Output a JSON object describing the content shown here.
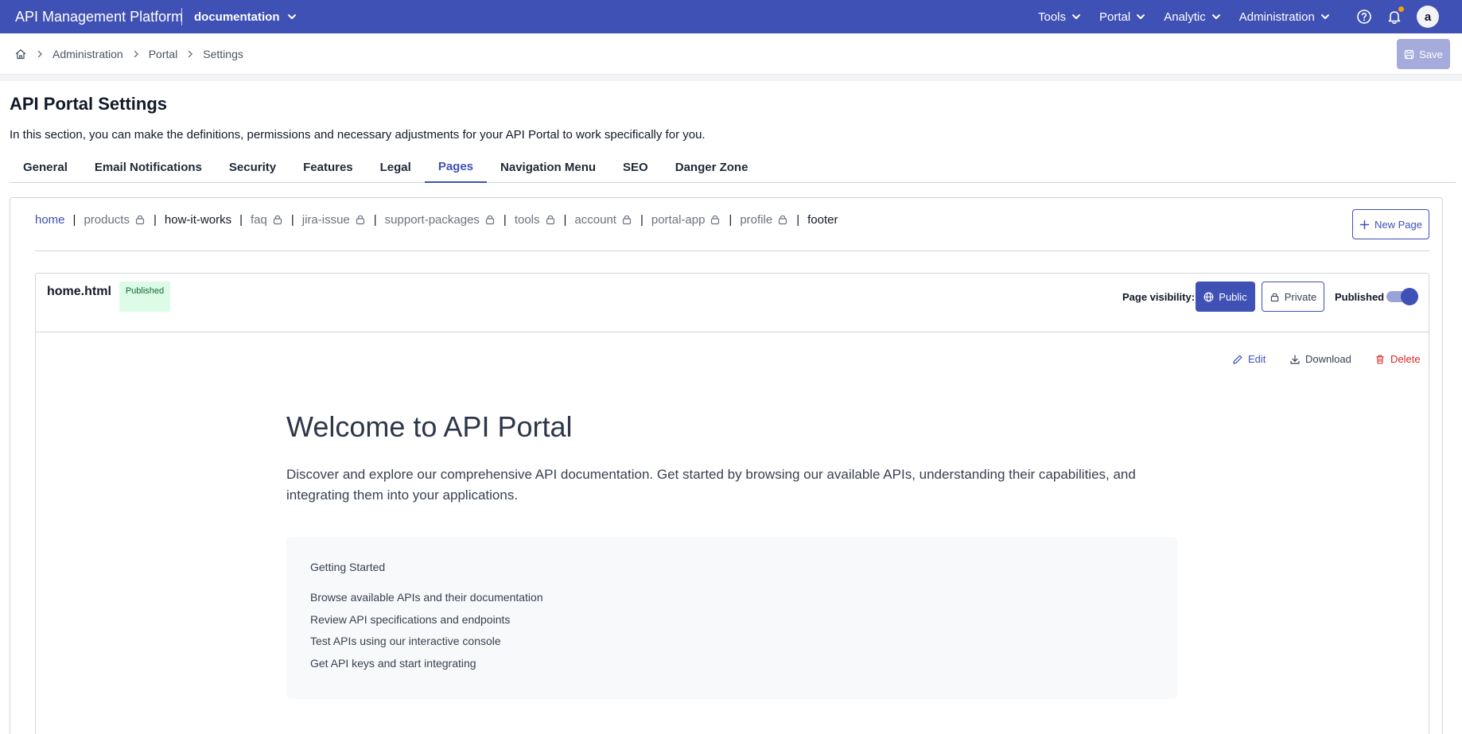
{
  "header": {
    "app_title": "API Management Platform",
    "workspace": "documentation",
    "nav": [
      "Tools",
      "Portal",
      "Analytic",
      "Administration"
    ],
    "avatar_initial": "a",
    "colors": {
      "primary": "#3f51b5",
      "notification_dot": "#f59e0b"
    }
  },
  "breadcrumb": {
    "items": [
      "Administration",
      "Portal",
      "Settings"
    ],
    "save_label": "Save"
  },
  "page": {
    "title": "API Portal Settings",
    "description": "In this section, you can make the definitions, permissions and necessary adjustments for your API Portal to work specifically for you."
  },
  "tabs": [
    {
      "label": "General"
    },
    {
      "label": "Email Notifications"
    },
    {
      "label": "Security"
    },
    {
      "label": "Features"
    },
    {
      "label": "Legal"
    },
    {
      "label": "Pages",
      "active": true
    },
    {
      "label": "Navigation Menu"
    },
    {
      "label": "SEO"
    },
    {
      "label": "Danger Zone"
    }
  ],
  "pages": {
    "items": [
      {
        "label": "home",
        "active": true,
        "locked": false
      },
      {
        "label": "products",
        "locked": true
      },
      {
        "label": "how-it-works",
        "locked": false
      },
      {
        "label": "faq",
        "locked": true
      },
      {
        "label": "jira-issue",
        "locked": true
      },
      {
        "label": "support-packages",
        "locked": true
      },
      {
        "label": "tools",
        "locked": true
      },
      {
        "label": "account",
        "locked": true
      },
      {
        "label": "portal-app",
        "locked": true
      },
      {
        "label": "profile",
        "locked": true
      },
      {
        "label": "footer",
        "locked": false
      }
    ],
    "new_page_label": "New Page"
  },
  "editor": {
    "file_name": "home.html",
    "status_badge": "Published",
    "visibility_label": "Page visibility:",
    "public_label": "Public",
    "private_label": "Private",
    "published_label": "Published",
    "published_on": true,
    "edit_label": "Edit",
    "download_label": "Download",
    "delete_label": "Delete"
  },
  "preview": {
    "heading": "Welcome to API Portal",
    "intro": "Discover and explore our comprehensive API documentation. Get started by browsing our available APIs, understanding their capabilities, and integrating them into your applications.",
    "getting_started_title": "Getting Started",
    "steps": [
      "Browse available APIs and their documentation",
      "Review API specifications and endpoints",
      "Test APIs using our interactive console",
      "Get API keys and start integrating"
    ]
  }
}
